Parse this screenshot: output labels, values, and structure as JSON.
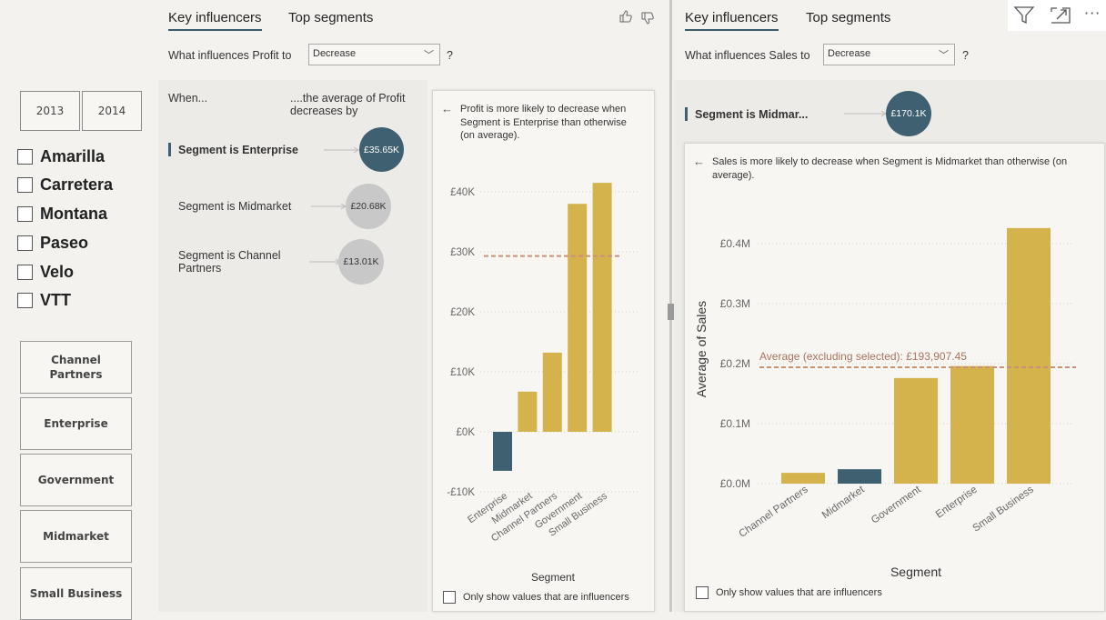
{
  "slicers": {
    "years": [
      "2013",
      "2014"
    ],
    "products": [
      "Amarilla",
      "Carretera",
      "Montana",
      "Paseo",
      "Velo",
      "VTT"
    ],
    "segments": [
      "Channel Partners",
      "Enterprise",
      "Government",
      "Midmarket",
      "Small Business"
    ]
  },
  "left_panel": {
    "tabs": [
      "Key influencers",
      "Top segments"
    ],
    "question_prefix": "What influences Profit to",
    "question_suffix": "?",
    "dropdown_value": "Decrease",
    "when_header": "When...",
    "avg_header": "....the average of Profit decreases by",
    "influencers": [
      {
        "label": "Segment is Enterprise",
        "value": "£35.65K",
        "selected": true
      },
      {
        "label": "Segment is Midmarket",
        "value": "£20.68K",
        "selected": false
      },
      {
        "label": "Segment is Channel Partners",
        "value": "£13.01K",
        "selected": false
      }
    ],
    "detail_text": "Profit is more likely to decrease when Segment is Enterprise than otherwise (on average).",
    "only_influencers_label": "Only show values that are influencers"
  },
  "right_panel": {
    "tabs": [
      "Key influencers",
      "Top segments"
    ],
    "question_prefix": "What influences Sales to",
    "question_suffix": "?",
    "dropdown_value": "Decrease",
    "influencer": {
      "label": "Segment is Midmar...",
      "value": "£170.1K"
    },
    "detail_text": "Sales is more likely to decrease when Segment is Midmarket than otherwise (on average).",
    "only_influencers_label": "Only show values that are influencers"
  },
  "icons": [
    "thumbs-up-icon",
    "thumbs-down-icon",
    "filter-icon",
    "expand-icon",
    "more-options-icon",
    "back-arrow-icon"
  ],
  "colors": {
    "accent": "#3f6070",
    "bar": "#d4b24c",
    "selected_bar": "#3f6070",
    "avg_line": "#c99278",
    "bubble_gray": "#c8c8c8"
  },
  "chart_data": [
    {
      "type": "bar",
      "categories": [
        "Enterprise",
        "Midmarket",
        "Channel Partners",
        "Government",
        "Small Business"
      ],
      "values": [
        -6500,
        6700,
        13200,
        38000,
        41500
      ],
      "highlighted": "Enterprise",
      "average_line": 29300,
      "xlabel": "Segment",
      "ylabel": "",
      "ylim": [
        -10000,
        40000
      ],
      "yticks": [
        -10000,
        0,
        10000,
        20000,
        30000,
        40000
      ],
      "ytick_labels": [
        "-£10K",
        "£0K",
        "£10K",
        "£20K",
        "£30K",
        "£40K"
      ],
      "grid": true
    },
    {
      "type": "bar",
      "categories": [
        "Channel Partners",
        "Midmarket",
        "Government",
        "Enterprise",
        "Small Business"
      ],
      "values": [
        18000,
        24000,
        176000,
        196000,
        426000
      ],
      "highlighted": "Midmarket",
      "average_line": 193907.45,
      "average_label": "Average (excluding selected): £193,907.45",
      "xlabel": "Segment",
      "ylabel": "Average of Sales",
      "ylim": [
        0,
        400000
      ],
      "yticks": [
        0,
        100000,
        200000,
        300000,
        400000
      ],
      "ytick_labels": [
        "£0.0M",
        "£0.1M",
        "£0.2M",
        "£0.3M",
        "£0.4M"
      ],
      "grid": true
    }
  ]
}
